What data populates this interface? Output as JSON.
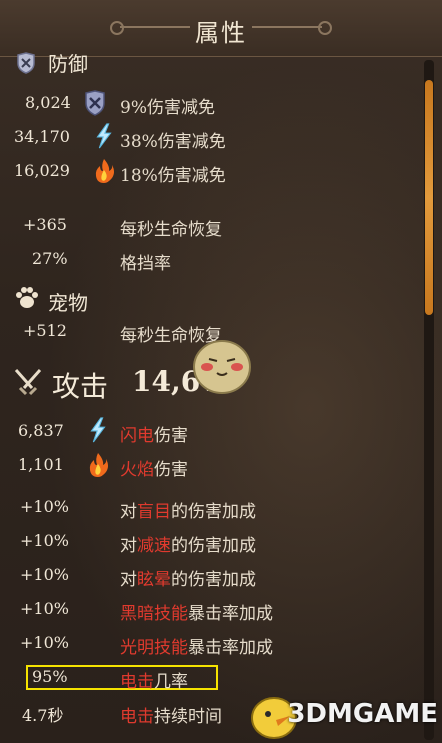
{
  "header": {
    "title": "属性"
  },
  "defense": {
    "title": "防御",
    "rows": [
      {
        "value": "8,024",
        "text": "9%伤害减免"
      },
      {
        "value": "34,170",
        "text": "38%伤害减免"
      },
      {
        "value": "16,029",
        "text": "18%伤害减免"
      }
    ],
    "regen": {
      "value": "+365",
      "text": "每秒生命恢复"
    },
    "block": {
      "value": "27%",
      "text": "格挡率"
    }
  },
  "pet": {
    "title": "宠物",
    "regen": {
      "value": "+512",
      "text": "每秒生命恢复"
    }
  },
  "attack": {
    "title": "攻击",
    "total": "14,647",
    "lightning": {
      "value": "6,837",
      "hl": "闪电",
      "rest": "伤害"
    },
    "fire": {
      "value": "1,101",
      "hl": "火焰",
      "rest": "伤害"
    },
    "bonuses": [
      {
        "value": "+10%",
        "pre": "对",
        "hl": "盲目",
        "rest": "的伤害加成"
      },
      {
        "value": "+10%",
        "pre": "对",
        "hl": "减速",
        "rest": "的伤害加成"
      },
      {
        "value": "+10%",
        "pre": "对",
        "hl": "眩晕",
        "rest": "的伤害加成"
      },
      {
        "value": "+10%",
        "pre": "",
        "hl": "黑暗技能",
        "rest": "暴击率加成"
      },
      {
        "value": "+10%",
        "pre": "",
        "hl": "光明技能",
        "rest": "暴击率加成"
      }
    ],
    "shock_chance": {
      "value": "95%",
      "hl": "电击",
      "rest": "几率"
    },
    "shock_duration": {
      "value": "4.7秒",
      "hl": "电击",
      "rest": "持续时间"
    }
  },
  "watermark": "3DMGAME",
  "colors": {
    "accent": "#e03a2e",
    "highlight_box": "#f5e300",
    "scroll_thumb": "#e29a3c"
  },
  "icons": {
    "defense": "shield-icon",
    "physical": "armor-icon",
    "lightning": "lightning-icon",
    "fire": "fire-icon",
    "pet": "paw-icon",
    "attack": "crossed-swords-icon"
  }
}
